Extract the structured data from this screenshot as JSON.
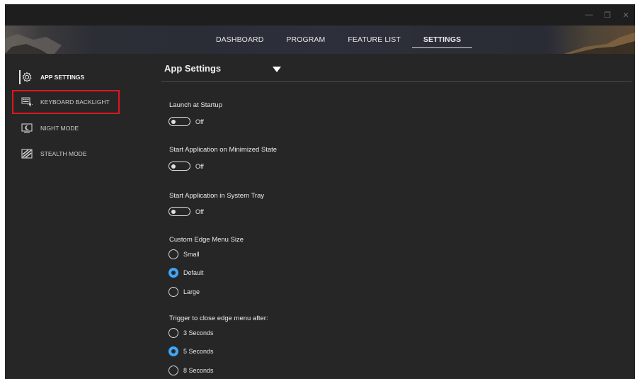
{
  "window": {
    "controls": [
      "—",
      "❐",
      "✕"
    ]
  },
  "nav": {
    "tabs": [
      {
        "label": "DASHBOARD",
        "active": false
      },
      {
        "label": "PROGRAM",
        "active": false
      },
      {
        "label": "FEATURE LIST",
        "active": false
      },
      {
        "label": "SETTINGS",
        "active": true
      }
    ]
  },
  "sidebar": {
    "items": [
      {
        "label": "APP SETTINGS",
        "icon": "gear-icon",
        "active": true
      },
      {
        "label": "KEYBOARD BACKLIGHT",
        "icon": "keyboard-backlight-icon",
        "active": false,
        "highlighted": true
      },
      {
        "label": "NIGHT MODE",
        "icon": "night-mode-icon",
        "active": false
      },
      {
        "label": "STEALTH MODE",
        "icon": "stealth-mode-icon",
        "active": false
      }
    ]
  },
  "main": {
    "title": "App Settings",
    "launch_startup": {
      "label": "Launch at Startup",
      "state": "Off"
    },
    "minimized_start": {
      "label": "Start Application on Minimized State",
      "state": "Off"
    },
    "tray_start": {
      "label": "Start Application in System Tray",
      "state": "Off"
    },
    "edge_menu_size": {
      "label": "Custom Edge Menu Size",
      "options": [
        "Small",
        "Default",
        "Large"
      ],
      "selected": "Default"
    },
    "close_trigger": {
      "label": "Trigger to close edge menu after:",
      "options": [
        "3 Seconds",
        "5 Seconds",
        "8 Seconds"
      ],
      "selected": "5 Seconds"
    }
  },
  "colors": {
    "accent": "#41a5f5",
    "highlight": "#e3141f",
    "background": "#262626"
  }
}
